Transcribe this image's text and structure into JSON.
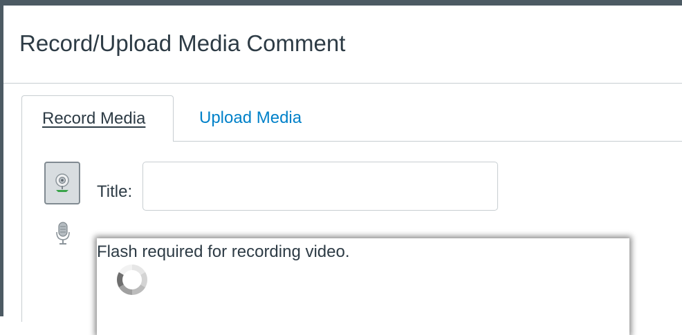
{
  "dialog": {
    "title": "Record/Upload Media Comment"
  },
  "tabs": [
    {
      "label": "Record Media",
      "active": true
    },
    {
      "label": "Upload Media",
      "active": false
    }
  ],
  "form": {
    "title_label": "Title:",
    "title_value": ""
  },
  "flash": {
    "message": "Flash required for recording video."
  },
  "icons": {
    "camera": "webcam-icon",
    "microphone": "microphone-icon",
    "loading": "loading-spinner-icon"
  },
  "colors": {
    "link": "#0081c9",
    "text": "#2d3b45",
    "border": "#c7cdd1",
    "overlay": "#4c5a63"
  }
}
